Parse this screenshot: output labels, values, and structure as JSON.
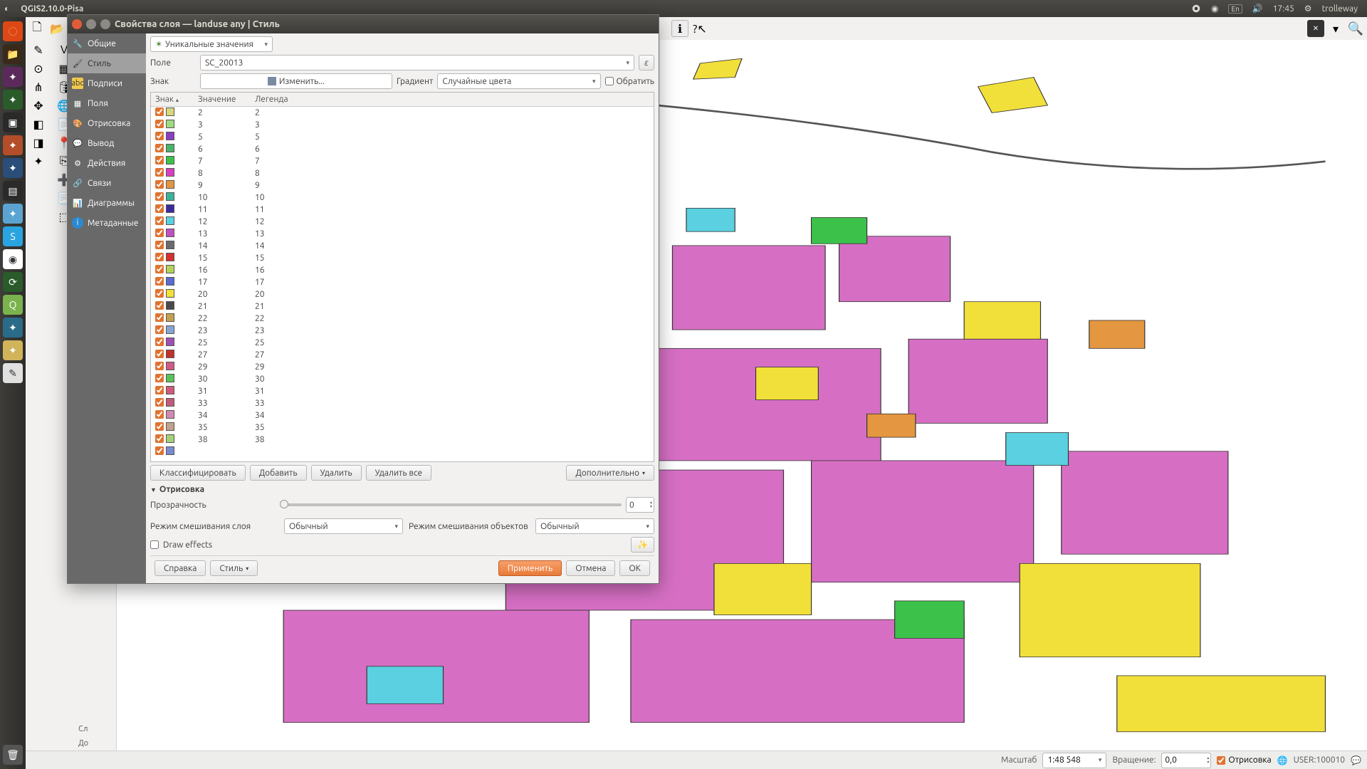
{
  "desktop": {
    "app_title": "QGIS2.10.0-Pisa",
    "clock": "17:45",
    "lang": "En",
    "user": "trolleway"
  },
  "dialog": {
    "title": "Свойства слоя — landuse any | Стиль",
    "nav": {
      "general": "Общие",
      "style": "Стиль",
      "labels": "Подписи",
      "fields": "Поля",
      "rendering": "Отрисовка",
      "display": "Вывод",
      "actions": "Действия",
      "joins": "Связи",
      "diagrams": "Диаграммы",
      "metadata": "Метаданные"
    },
    "renderer_type": "Уникальные значения",
    "field_label": "Поле",
    "field_value": "SC_20013",
    "symbol_label": "Знак",
    "change_btn": "Изменить...",
    "gradient_label": "Градиент",
    "gradient_value": "Случайные цвета",
    "invert_label": "Обратить",
    "headers": {
      "sign": "Знак",
      "value": "Значение",
      "legend": "Легенда"
    },
    "classes": [
      {
        "color": "#d7d97a",
        "value": "2",
        "legend": "2"
      },
      {
        "color": "#9edb7f",
        "value": "3",
        "legend": "3"
      },
      {
        "color": "#8a3fc2",
        "value": "5",
        "legend": "5"
      },
      {
        "color": "#4bb36c",
        "value": "6",
        "legend": "6"
      },
      {
        "color": "#3cc24a",
        "value": "7",
        "legend": "7"
      },
      {
        "color": "#d93fc2",
        "value": "8",
        "legend": "8"
      },
      {
        "color": "#e49640",
        "value": "9",
        "legend": "9"
      },
      {
        "color": "#3cb39a",
        "value": "10",
        "legend": "10"
      },
      {
        "color": "#3b2aa0",
        "value": "11",
        "legend": "11"
      },
      {
        "color": "#5bd0e0",
        "value": "12",
        "legend": "12"
      },
      {
        "color": "#c24fc2",
        "value": "13",
        "legend": "13"
      },
      {
        "color": "#6b6b6b",
        "value": "14",
        "legend": "14"
      },
      {
        "color": "#d73030",
        "value": "15",
        "legend": "15"
      },
      {
        "color": "#b4d15a",
        "value": "16",
        "legend": "16"
      },
      {
        "color": "#5a6bd1",
        "value": "17",
        "legend": "17"
      },
      {
        "color": "#f2e03a",
        "value": "20",
        "legend": "20"
      },
      {
        "color": "#4a4a4a",
        "value": "21",
        "legend": "21"
      },
      {
        "color": "#c2a24f",
        "value": "22",
        "legend": "22"
      },
      {
        "color": "#8aa4d1",
        "value": "23",
        "legend": "23"
      },
      {
        "color": "#a04fb3",
        "value": "25",
        "legend": "25"
      },
      {
        "color": "#c23030",
        "value": "27",
        "legend": "27"
      },
      {
        "color": "#d15a8a",
        "value": "29",
        "legend": "29"
      },
      {
        "color": "#5ac25a",
        "value": "30",
        "legend": "30"
      },
      {
        "color": "#d15a7a",
        "value": "31",
        "legend": "31"
      },
      {
        "color": "#c25a7a",
        "value": "33",
        "legend": "33"
      },
      {
        "color": "#d18ab3",
        "value": "34",
        "legend": "34"
      },
      {
        "color": "#c2a28a",
        "value": "35",
        "legend": "35"
      },
      {
        "color": "#a4d17a",
        "value": "38",
        "legend": "38"
      },
      {
        "color": "#7a8ad1",
        "value": "",
        "legend": ""
      }
    ],
    "classify_btn": "Классифицировать",
    "add_btn": "Добавить",
    "delete_btn": "Удалить",
    "delete_all_btn": "Удалить все",
    "advanced_btn": "Дополнительно",
    "rendering_section": "Отрисовка",
    "transparency_label": "Прозрачность",
    "transparency_value": "0",
    "blend_layer_label": "Режим смешивания слоя",
    "blend_layer_value": "Обычный",
    "blend_feature_label": "Режим смешивания объектов",
    "blend_feature_value": "Обычный",
    "draw_effects_label": "Draw effects",
    "help_btn": "Справка",
    "style_btn": "Стиль",
    "apply_btn": "Применить",
    "cancel_btn": "Отмена",
    "ok_btn": "OK"
  },
  "statusbar": {
    "scale_label": "Масштаб",
    "scale_value": "1:48 548",
    "rotation_label": "Вращение:",
    "rotation_value": "0,0",
    "render_label": "Отрисовка",
    "crs": "USER:100010"
  },
  "panels": {
    "layers": "Сл",
    "add": "До",
    "sl": "Сл"
  },
  "colors": {
    "accent": "#e07330"
  }
}
